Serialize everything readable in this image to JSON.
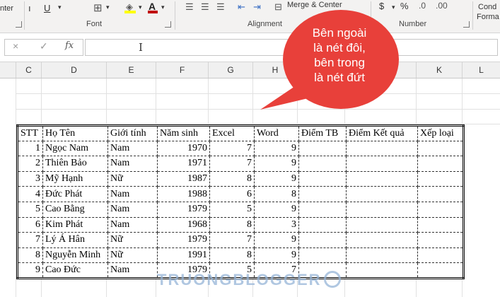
{
  "ribbon": {
    "clipboard_fragment": "nter",
    "font_group": "Font",
    "alignment_group": "Alignment",
    "merge_center": "Merge & Center",
    "number_group": "Number",
    "conditional_fragment": "Cond",
    "format_fragment": "Forma",
    "currency_symbol": "$",
    "percent_symbol": "%",
    "font_color": "#c00000",
    "fill_color": "#ffff00"
  },
  "formula_bar": {
    "cancel_icon": "×",
    "enter_icon": "✓",
    "fx_label": "fx",
    "value": ""
  },
  "columns": [
    "C",
    "D",
    "E",
    "F",
    "G",
    "H",
    "I",
    "J",
    "K",
    "L"
  ],
  "table": {
    "headers": [
      "STT",
      "Họ Tên",
      "Giới tính",
      "Năm sinh",
      "Excel",
      "Word",
      "Điểm TB",
      "Điểm Kết quả",
      "Xếp loại"
    ],
    "rows": [
      [
        "1",
        "Ngọc Nam",
        "Nam",
        "1970",
        "7",
        "9",
        "",
        "",
        ""
      ],
      [
        "2",
        "Thiên Bảo",
        "Nam",
        "1971",
        "7",
        "9",
        "",
        "",
        ""
      ],
      [
        "3",
        "Mỹ Hạnh",
        "Nữ",
        "1987",
        "8",
        "9",
        "",
        "",
        ""
      ],
      [
        "4",
        "Đức Phát",
        "Nam",
        "1988",
        "6",
        "8",
        "",
        "",
        ""
      ],
      [
        "5",
        "Cao Bằng",
        "Nam",
        "1979",
        "5",
        "9",
        "",
        "",
        ""
      ],
      [
        "6",
        "Kim Phát",
        "Nam",
        "1968",
        "8",
        "3",
        "",
        "",
        ""
      ],
      [
        "7",
        "Lý Á Hân",
        "Nữ",
        "1979",
        "7",
        "9",
        "",
        "",
        ""
      ],
      [
        "8",
        "Nguyễn Minh",
        "Nữ",
        "1991",
        "8",
        "9",
        "",
        "",
        ""
      ],
      [
        "9",
        "Cao Đức",
        "Nam",
        "1979",
        "5",
        "7",
        "",
        "",
        ""
      ]
    ]
  },
  "callout": {
    "lines": [
      "Bên ngoài",
      "là nét đôi,",
      "bên trong",
      "là nét đứt"
    ],
    "color": "#e8403a"
  },
  "watermark": "TRUONGBLOGGER"
}
